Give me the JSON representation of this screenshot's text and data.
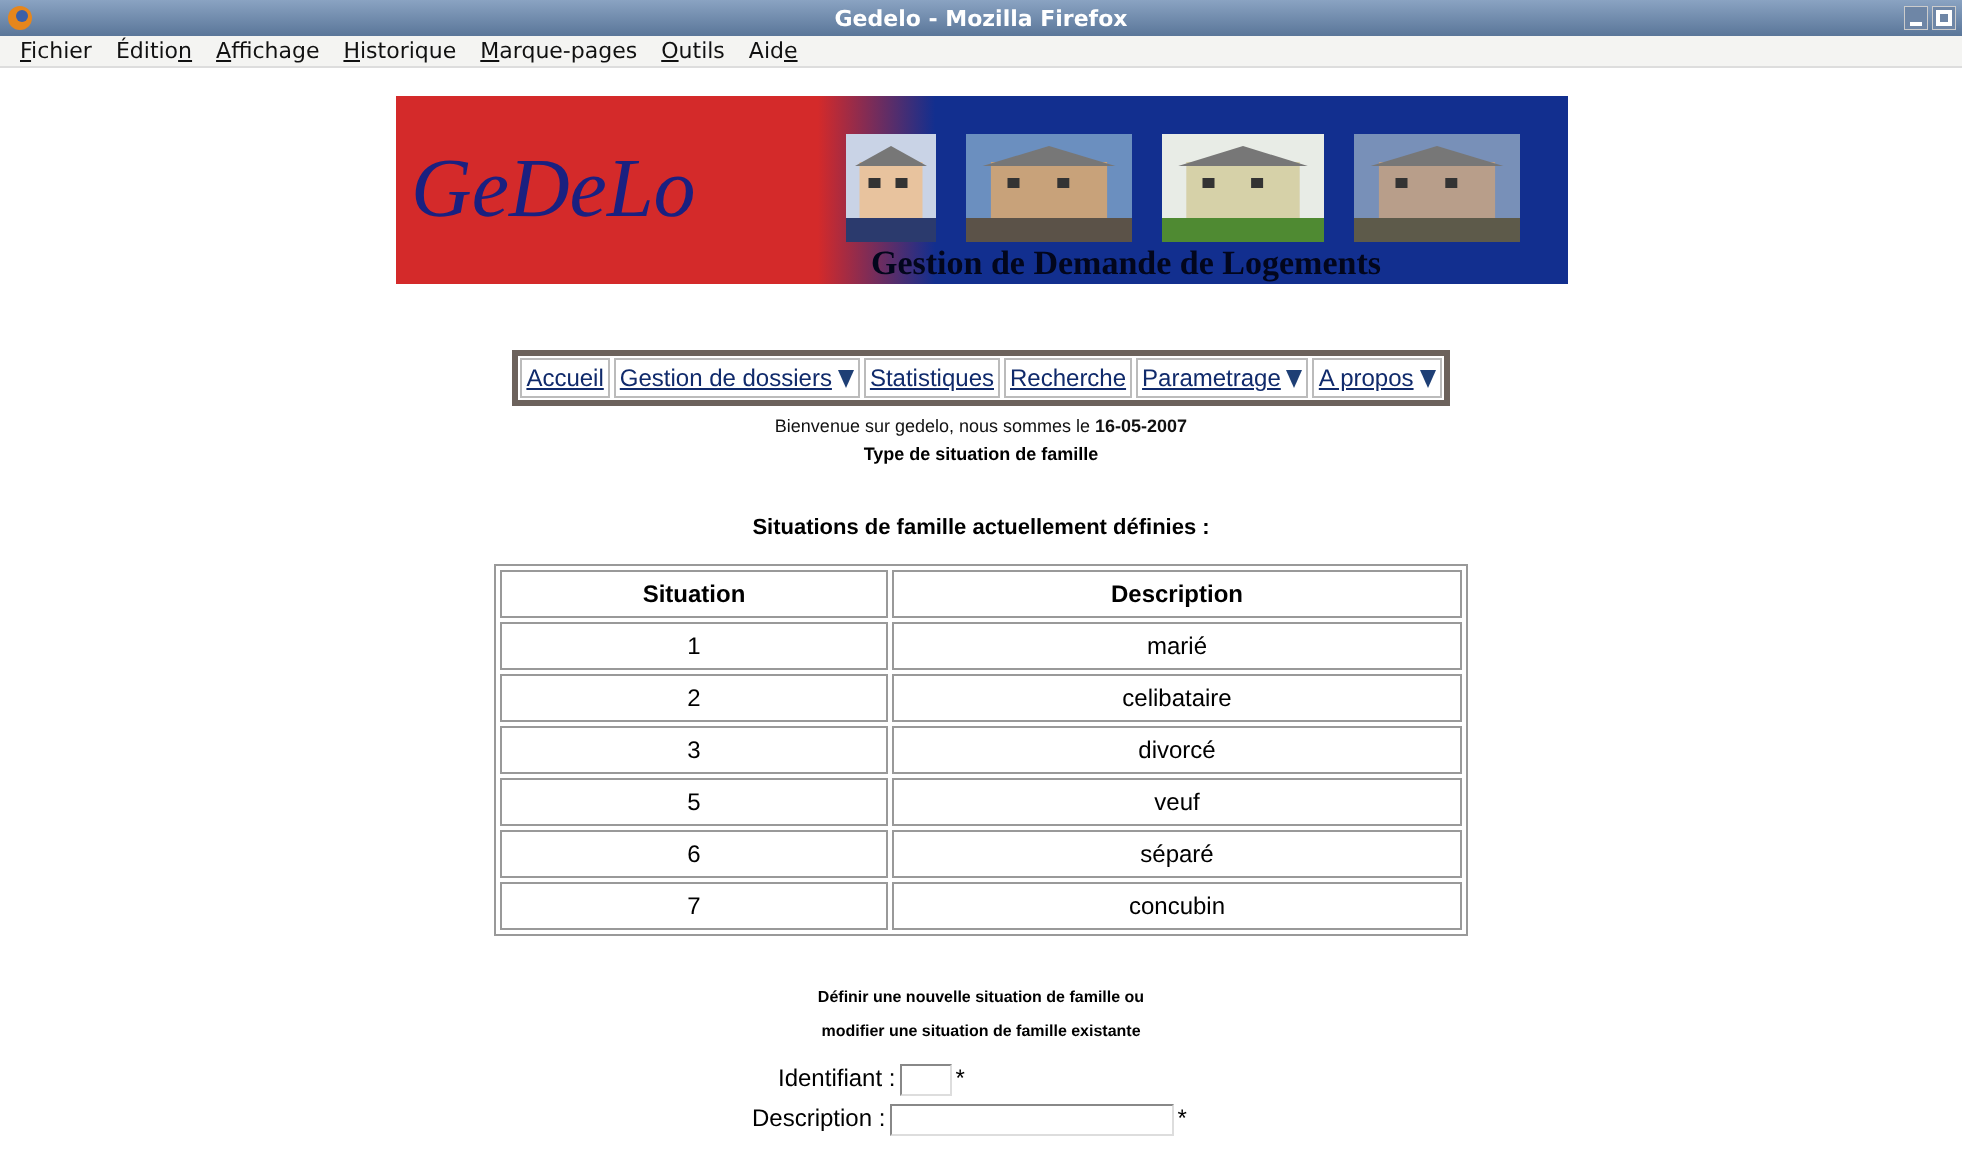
{
  "window": {
    "title": "Gedelo - Mozilla Firefox"
  },
  "menu": [
    {
      "key": "F",
      "post": "ichier"
    },
    {
      "pre": "Éditio",
      "key": "n"
    },
    {
      "key": "A",
      "post": "ffichage"
    },
    {
      "key": "H",
      "post": "istorique"
    },
    {
      "key": "M",
      "post": "arque-pages"
    },
    {
      "key": "O",
      "post": "utils"
    },
    {
      "pre": "Aid",
      "key": "e"
    }
  ],
  "banner": {
    "logo": "GeDeLo",
    "subtitle": "Gestion de Demande de Logements"
  },
  "nav": [
    {
      "label": "Accueil",
      "dropdown": false
    },
    {
      "label": "Gestion de dossiers",
      "dropdown": true
    },
    {
      "label": "Statistiques",
      "dropdown": false
    },
    {
      "label": "Recherche",
      "dropdown": false
    },
    {
      "label": "Parametrage",
      "dropdown": true
    },
    {
      "label": "A propos",
      "dropdown": true
    }
  ],
  "welcome": {
    "text": "Bienvenue sur gedelo, nous sommes le **16-05-2007**"
  },
  "page_title": "Type de situation de famille",
  "table": {
    "title": "Situations de famille actuellement définies :",
    "columns": [
      "Situation",
      "Description"
    ],
    "rows": [
      [
        "1",
        "marié"
      ],
      [
        "2",
        "celibataire"
      ],
      [
        "3",
        "divorcé"
      ],
      [
        "5",
        "veuf"
      ],
      [
        "6",
        "séparé"
      ],
      [
        "7",
        "concubin"
      ]
    ]
  },
  "form": {
    "heading": [
      "Définir une nouvelle situation de famille ou",
      "modifier une situation de famille existante"
    ],
    "fields": [
      {
        "label": "Identifiant :",
        "required": "*",
        "kind": "short"
      },
      {
        "label": "Description :",
        "required": "*",
        "kind": "long"
      }
    ]
  }
}
